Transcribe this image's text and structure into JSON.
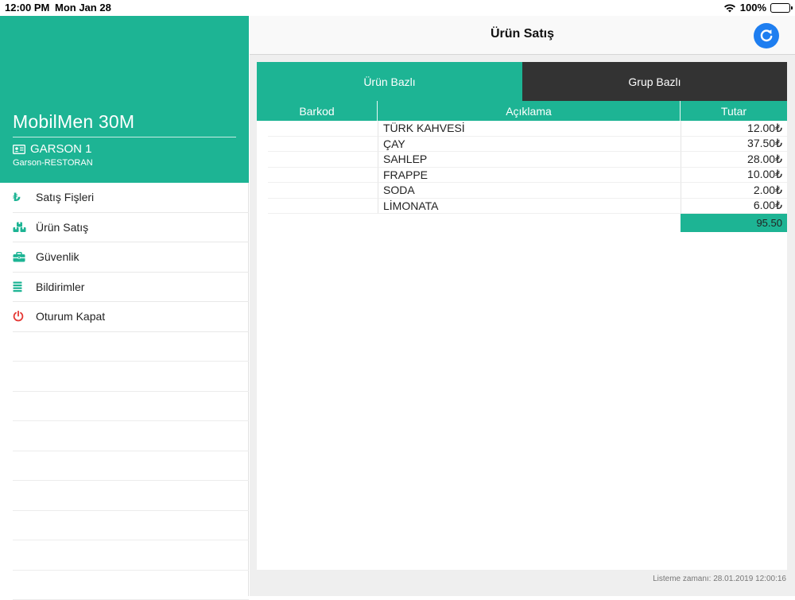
{
  "status_bar": {
    "time": "12:00 PM",
    "date": "Mon Jan 28",
    "battery": "100%"
  },
  "sidebar": {
    "app_title": "MobilMen 30M",
    "user_name": "GARSON 1",
    "user_role": "Garson-RESTORAN",
    "menu_items": [
      {
        "label": "Satış Fişleri",
        "icon": "lira-icon"
      },
      {
        "label": "Ürün Satış",
        "icon": "boxes-icon"
      },
      {
        "label": "Güvenlik",
        "icon": "briefcase-icon"
      },
      {
        "label": "Bildirimler",
        "icon": "list-icon"
      },
      {
        "label": "Oturum Kapat",
        "icon": "power-icon"
      }
    ]
  },
  "navbar": {
    "title": "Ürün Satış"
  },
  "tabs": [
    {
      "label": "Ürün Bazlı",
      "active": true
    },
    {
      "label": "Grup Bazlı",
      "active": false
    }
  ],
  "table": {
    "columns": [
      "Barkod",
      "Açıklama",
      "Tutar"
    ],
    "rows": [
      {
        "barkod": "",
        "aciklama": "TÜRK KAHVESİ",
        "tutar": "12.00₺"
      },
      {
        "barkod": "",
        "aciklama": "ÇAY",
        "tutar": "37.50₺"
      },
      {
        "barkod": "",
        "aciklama": "SAHLEP",
        "tutar": "28.00₺"
      },
      {
        "barkod": "",
        "aciklama": "FRAPPE",
        "tutar": "10.00₺"
      },
      {
        "barkod": "",
        "aciklama": "SODA",
        "tutar": "2.00₺"
      },
      {
        "barkod": "",
        "aciklama": "LİMONATA",
        "tutar": "6.00₺"
      }
    ],
    "total": "95.50"
  },
  "footer": {
    "list_time": "Listeme zamanı: 28.01.2019 12:00:16"
  },
  "colors": {
    "accent": "#1db494",
    "dark_tab": "#333333",
    "refresh": "#1e7ef0",
    "power": "#e53935"
  }
}
